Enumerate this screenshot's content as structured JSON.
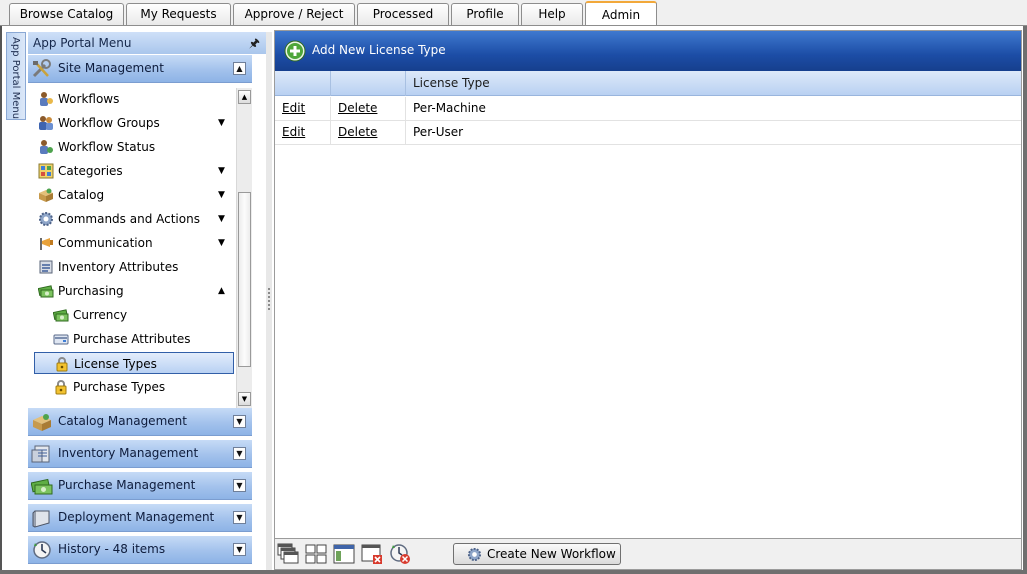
{
  "tabs": [
    {
      "label": "Browse Catalog",
      "active": false
    },
    {
      "label": "My Requests",
      "active": false
    },
    {
      "label": "Approve / Reject",
      "active": false
    },
    {
      "label": "Processed",
      "active": false
    },
    {
      "label": "Profile",
      "active": false
    },
    {
      "label": "Help",
      "active": false
    },
    {
      "label": "Admin",
      "active": true
    }
  ],
  "side_strip": {
    "label": "App Portal Menu"
  },
  "menu": {
    "title": "App Portal Menu",
    "site_management": {
      "label": "Site Management",
      "icon": "tools-icon",
      "state": "expanded"
    },
    "items": [
      {
        "label": "Workflows",
        "icon": "workflow-icon",
        "has_dropdown": false,
        "sub": false,
        "selected": false
      },
      {
        "label": "Workflow Groups",
        "icon": "workflow-groups-icon",
        "has_dropdown": true,
        "expanded": false,
        "sub": false,
        "selected": false
      },
      {
        "label": "Workflow Status",
        "icon": "workflow-status-icon",
        "has_dropdown": false,
        "sub": false,
        "selected": false
      },
      {
        "label": "Categories",
        "icon": "categories-icon",
        "has_dropdown": true,
        "expanded": false,
        "sub": false,
        "selected": false
      },
      {
        "label": "Catalog",
        "icon": "catalog-box-icon",
        "has_dropdown": true,
        "expanded": false,
        "sub": false,
        "selected": false
      },
      {
        "label": "Commands and Actions",
        "icon": "gear-icon",
        "has_dropdown": true,
        "expanded": false,
        "sub": false,
        "selected": false
      },
      {
        "label": "Communication",
        "icon": "megaphone-icon",
        "has_dropdown": true,
        "expanded": false,
        "sub": false,
        "selected": false
      },
      {
        "label": "Inventory Attributes",
        "icon": "inventory-icon",
        "has_dropdown": false,
        "sub": false,
        "selected": false
      },
      {
        "label": "Purchasing",
        "icon": "money-icon",
        "has_dropdown": true,
        "expanded": true,
        "sub": false,
        "selected": false
      },
      {
        "label": "Currency",
        "icon": "money-icon",
        "has_dropdown": false,
        "sub": true,
        "selected": false
      },
      {
        "label": "Purchase Attributes",
        "icon": "card-icon",
        "has_dropdown": false,
        "sub": true,
        "selected": false
      },
      {
        "label": "License Types",
        "icon": "lock-icon",
        "has_dropdown": false,
        "sub": true,
        "selected": true
      },
      {
        "label": "Purchase Types",
        "icon": "lock-icon",
        "has_dropdown": false,
        "sub": true,
        "selected": false
      }
    ],
    "groups": [
      {
        "label": "Catalog Management",
        "icon": "catalog-management-icon"
      },
      {
        "label": "Inventory Management",
        "icon": "inventory-management-icon"
      },
      {
        "label": "Purchase Management",
        "icon": "purchase-management-icon"
      },
      {
        "label": "Deployment Management",
        "icon": "deployment-management-icon"
      },
      {
        "label": "History - 48 items",
        "icon": "history-icon"
      }
    ]
  },
  "main": {
    "add_label": "Add New License Type",
    "columns": [
      "",
      "",
      "License Type"
    ],
    "rows": [
      {
        "edit": "Edit",
        "delete": "Delete",
        "type": "Per-Machine"
      },
      {
        "edit": "Edit",
        "delete": "Delete",
        "type": "Per-User"
      }
    ],
    "footer": {
      "icons": [
        "cascade-windows-icon",
        "tile-windows-icon",
        "window-layout-icon",
        "close-windows-icon",
        "clock-cancel-icon"
      ],
      "create_button": "Create New Workflow"
    }
  },
  "colors": {
    "header_blue": "#1c4da6",
    "menu_bar": "#a3c2ec",
    "active_tab": "#f2a83a"
  }
}
